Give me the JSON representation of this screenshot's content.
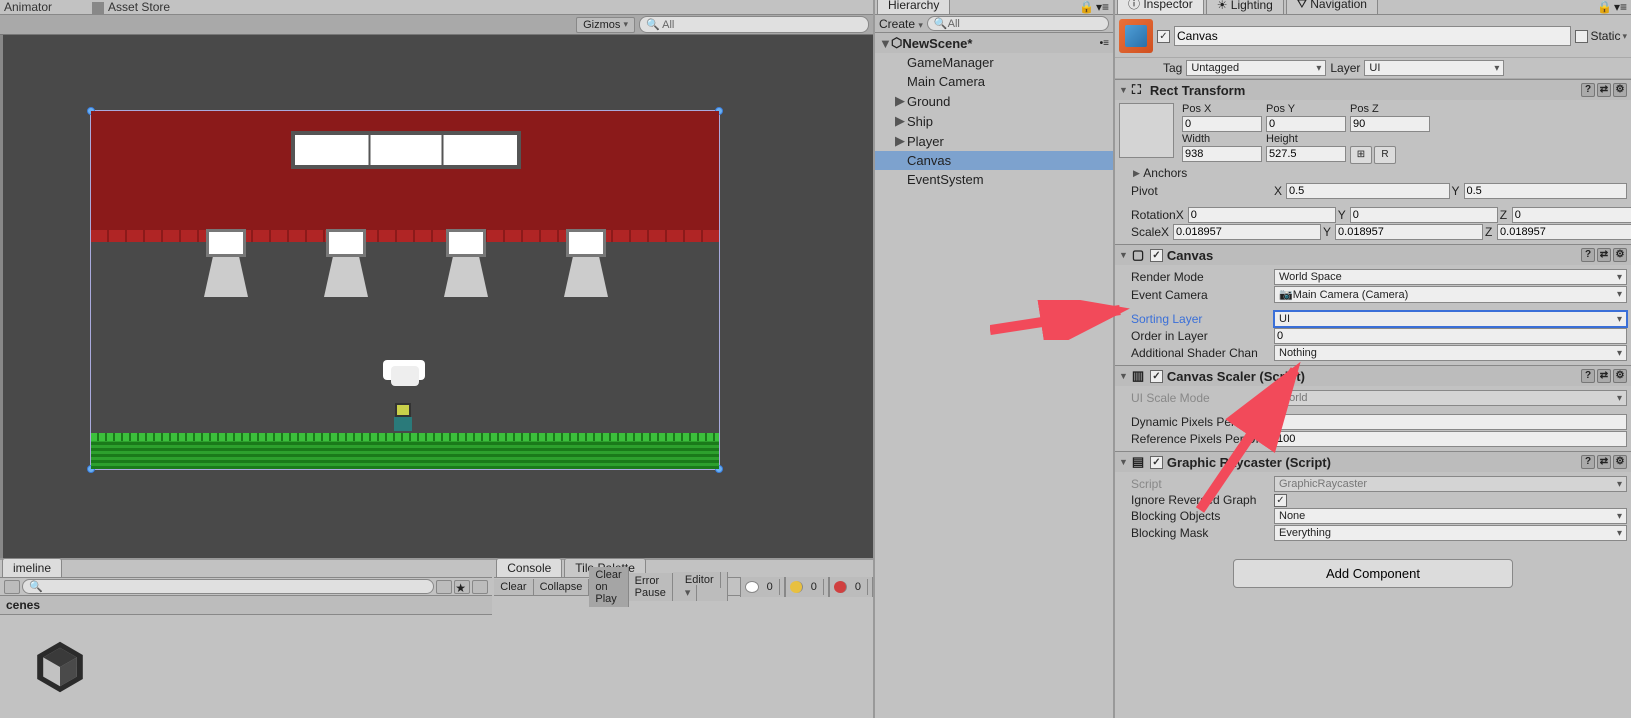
{
  "topTabs": {
    "animator": "Animator",
    "assetStore": "Asset Store"
  },
  "sceneToolbar": {
    "gizmos": "Gizmos",
    "searchPlaceholder": "All"
  },
  "hierarchy": {
    "title": "Hierarchy",
    "create": "Create",
    "searchPlaceholder": "All",
    "scene": "NewScene*",
    "items": [
      "GameManager",
      "Main Camera",
      "Ground",
      "Ship",
      "Player",
      "Canvas",
      "EventSystem"
    ],
    "sel": 5,
    "foldable": [
      2,
      3,
      4
    ]
  },
  "inspector": {
    "tabs": [
      "Inspector",
      "Lighting",
      "Navigation"
    ],
    "activeTab": 0,
    "name": "Canvas",
    "static": "Static",
    "tagLabel": "Tag",
    "tag": "Untagged",
    "layerLabel": "Layer",
    "layer": "UI",
    "rect": {
      "title": "Rect Transform",
      "posX": "0",
      "posY": "0",
      "posZ": "90",
      "width": "938",
      "height": "527.5",
      "posXLabel": "Pos X",
      "posYLabel": "Pos Y",
      "posZLabel": "Pos Z",
      "widthLabel": "Width",
      "heightLabel": "Height",
      "anchors": "Anchors",
      "pivotLabel": "Pivot",
      "pivotX": "0.5",
      "pivotY": "0.5",
      "rotationLabel": "Rotation",
      "rotX": "0",
      "rotY": "0",
      "rotZ": "0",
      "scaleLabel": "Scale",
      "scaleX": "0.018957",
      "scaleY": "0.018957",
      "scaleZ": "0.018957",
      "R": "R"
    },
    "canvas": {
      "title": "Canvas",
      "renderModeLabel": "Render Mode",
      "renderMode": "World Space",
      "eventCameraLabel": "Event Camera",
      "eventCamera": "Main Camera (Camera)",
      "sortingLayerLabel": "Sorting Layer",
      "sortingLayer": "UI",
      "orderLabel": "Order in Layer",
      "order": "0",
      "shaderLabel": "Additional Shader Chan",
      "shader": "Nothing"
    },
    "scaler": {
      "title": "Canvas Scaler (Script)",
      "modeLabel": "UI Scale Mode",
      "mode": "World",
      "dppuLabel": "Dynamic Pixels Per Unit",
      "dppu": "1",
      "rppuLabel": "Reference Pixels Per Un",
      "rppu": "100"
    },
    "raycaster": {
      "title": "Graphic Raycaster (Script)",
      "scriptLabel": "Script",
      "script": "GraphicRaycaster",
      "ignoreLabel": "Ignore Reversed Graph",
      "blockObjLabel": "Blocking Objects",
      "blockObj": "None",
      "blockMaskLabel": "Blocking Mask",
      "blockMask": "Everything"
    },
    "addComponent": "Add Component"
  },
  "timeline": {
    "tab": "imeline",
    "scenes": "cenes",
    "console": "Console",
    "tilePalette": "Tile Palette",
    "clear": "Clear",
    "collapse": "Collapse",
    "clearPlay": "Clear on Play",
    "errorPause": "Error Pause",
    "editor": "Editor",
    "count0": "0"
  }
}
